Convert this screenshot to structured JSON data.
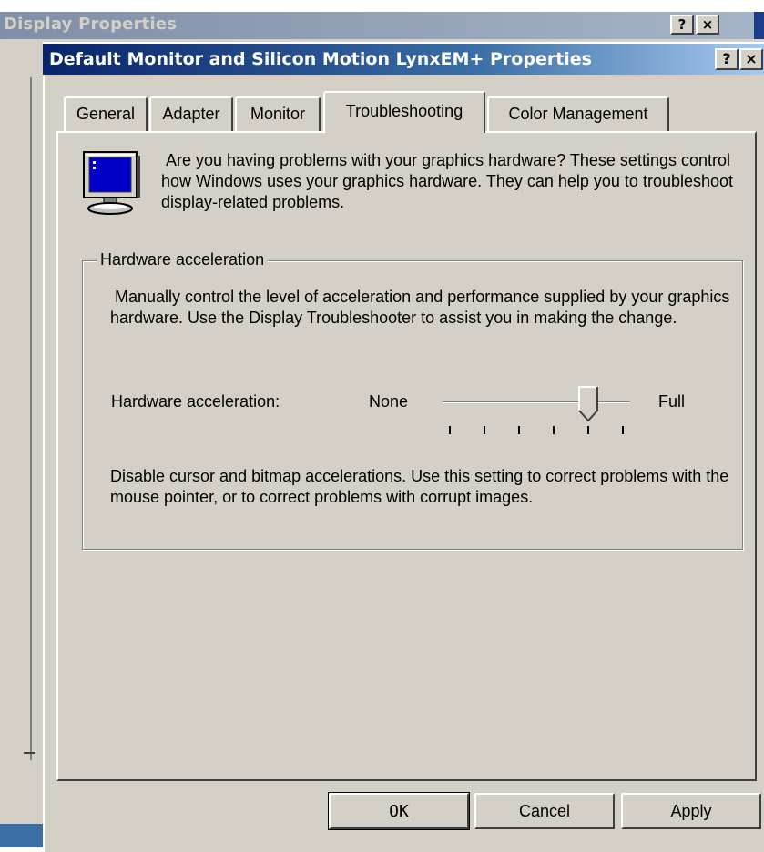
{
  "background_window": {
    "title": "Display Properties",
    "help_glyph": "?",
    "close_glyph": "×"
  },
  "dialog": {
    "title": "Default Monitor and Silicon Motion LynxEM+ Properties",
    "help_glyph": "?",
    "close_glyph": "×"
  },
  "tabs": [
    {
      "label": "General",
      "active": false
    },
    {
      "label": "Adapter",
      "active": false
    },
    {
      "label": "Monitor",
      "active": false
    },
    {
      "label": "Troubleshooting",
      "active": true
    },
    {
      "label": "Color Management",
      "active": false
    }
  ],
  "intro": {
    "icon": "monitor-icon",
    "text": "Are you having problems with your graphics hardware? These settings control how Windows uses your graphics hardware. They can help you to troubleshoot display-related problems."
  },
  "hardware_acceleration": {
    "group_label": "Hardware acceleration",
    "description": "Manually control the level of acceleration and performance supplied by your graphics hardware. Use the Display Troubleshooter to assist you in making the change.",
    "slider_label": "Hardware acceleration:",
    "min_label": "None",
    "max_label": "Full",
    "steps": 6,
    "current_step": 5,
    "status_text": "Disable cursor and bitmap accelerations. Use this setting to correct problems with the mouse pointer, or to correct problems with corrupt images."
  },
  "buttons": {
    "ok": "OK",
    "cancel": "Cancel",
    "apply": "Apply"
  },
  "colors": {
    "title_active_start": "#0a246a",
    "title_active_end": "#a6caf0",
    "face": "#d4d0c8"
  }
}
